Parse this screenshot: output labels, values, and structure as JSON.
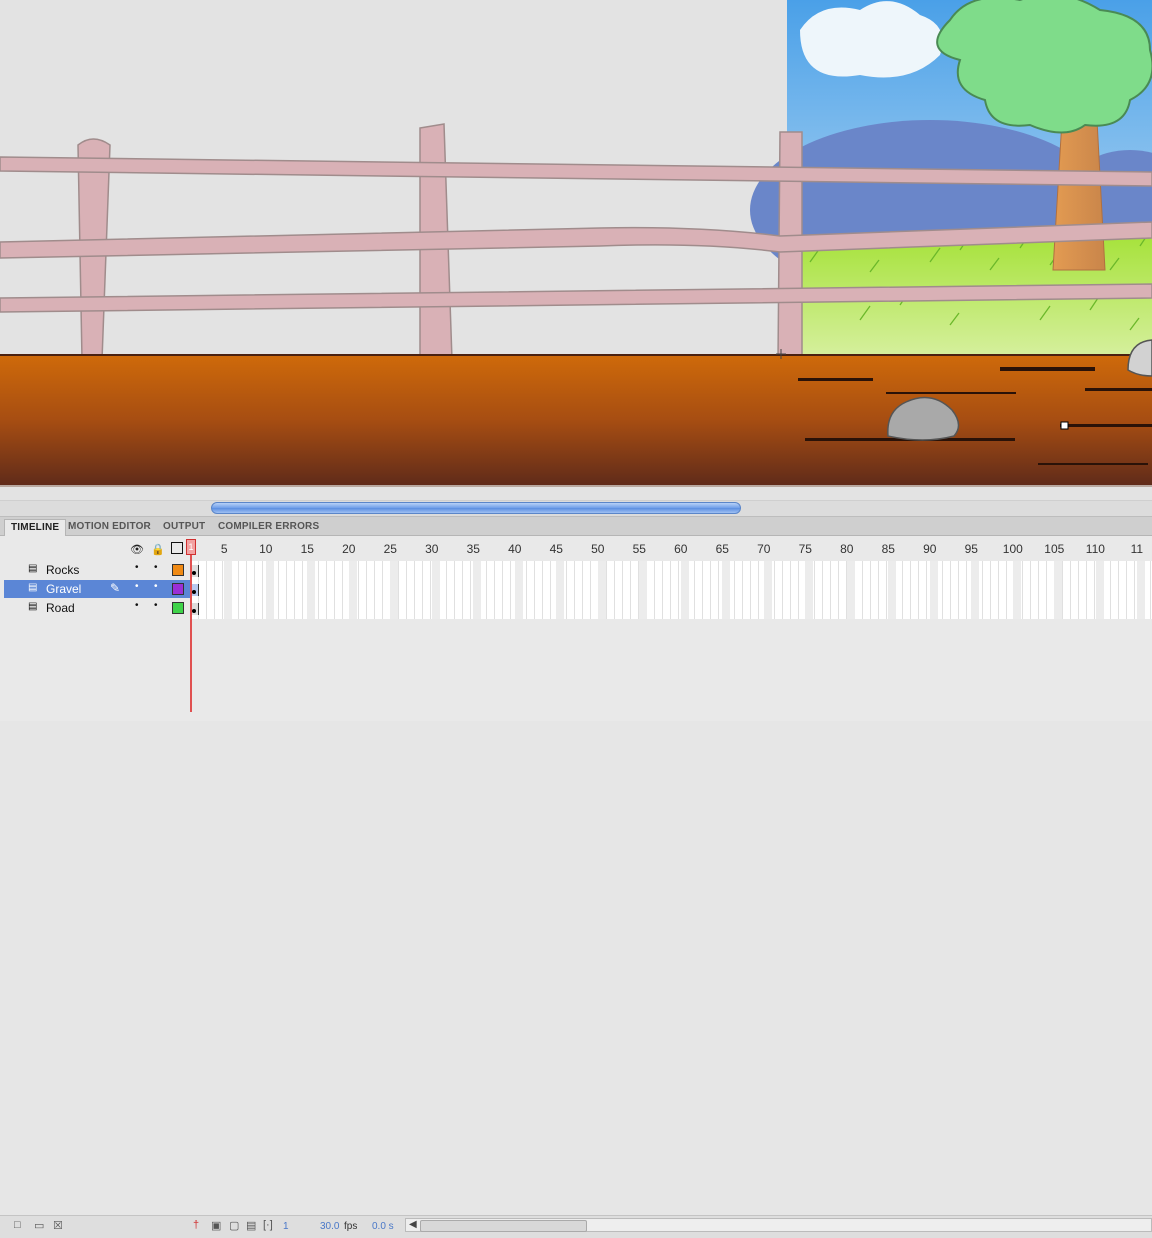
{
  "timeline": {
    "tabs": [
      "TIMELINE",
      "MOTION EDITOR",
      "OUTPUT",
      "COMPILER ERRORS"
    ],
    "active_tab": "TIMELINE",
    "ruler": [
      "1",
      "5",
      "10",
      "15",
      "20",
      "25",
      "30",
      "35",
      "40",
      "45",
      "50",
      "55",
      "60",
      "65",
      "70",
      "75",
      "80",
      "85",
      "90",
      "95",
      "100",
      "105",
      "110",
      "11"
    ],
    "current_frame": "1",
    "layers": [
      {
        "name": "Rocks",
        "color": "#f08a14",
        "selected": false
      },
      {
        "name": "Gravel",
        "color": "#9b2fd6",
        "selected": true
      },
      {
        "name": "Road",
        "color": "#3fd34a",
        "selected": false
      }
    ],
    "footer": {
      "frame": "1",
      "fps_value": "30.0",
      "fps_unit": "fps",
      "time": "0.0 s"
    }
  },
  "icons": {
    "eye": "eye-icon",
    "lock": "lock-icon",
    "outline": "outline-icon",
    "pencil": "pencil-icon",
    "layer": "layer-icon"
  }
}
